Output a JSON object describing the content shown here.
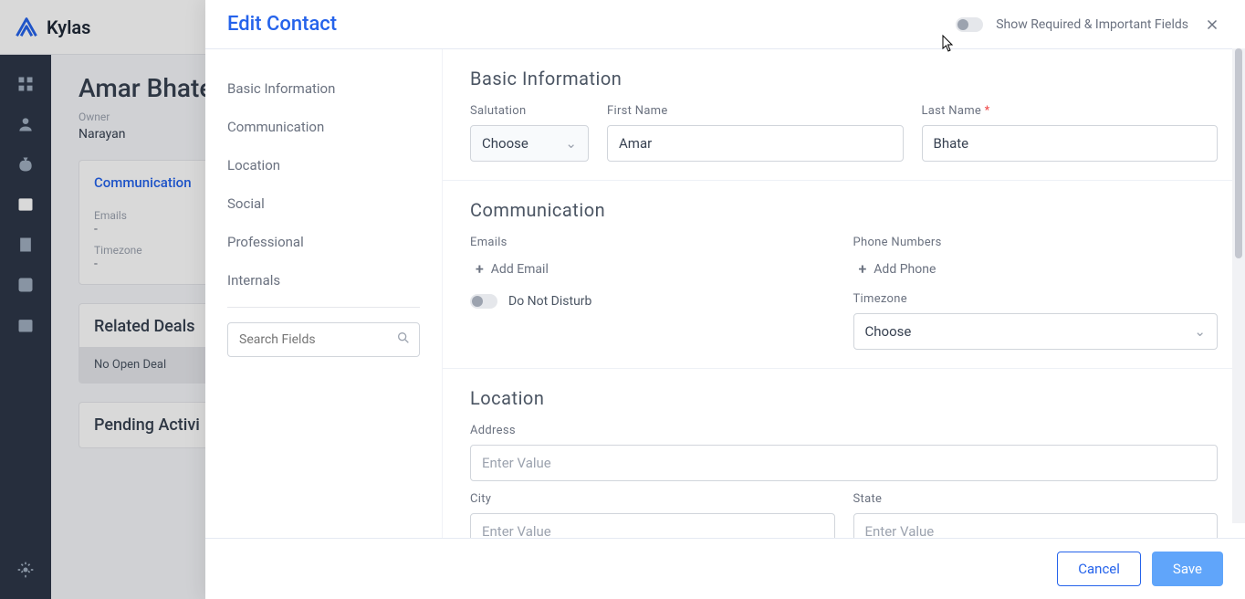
{
  "app": {
    "name": "Kylas"
  },
  "background": {
    "contact_name": "Amar Bhate(",
    "owner_label": "Owner",
    "owner_name": "Narayan",
    "tab_communication": "Communication",
    "emails_label": "Emails",
    "emails_value": "-",
    "timezone_label": "Timezone",
    "timezone_value": "-",
    "related_deals_title": "Related Deals",
    "no_open_deal": "No Open Deal",
    "de_partial": "De",
    "pending_activities": "Pending Activi"
  },
  "modal": {
    "title": "Edit Contact",
    "toggle_label": "Show Required & Important Fields",
    "sidebar": {
      "items": [
        "Basic Information",
        "Communication",
        "Location",
        "Social",
        "Professional",
        "Internals"
      ],
      "search_placeholder": "Search Fields"
    },
    "sections": {
      "basic": {
        "title": "Basic Information",
        "salutation_label": "Salutation",
        "salutation_value": "Choose",
        "first_name_label": "First Name",
        "first_name_value": "Amar",
        "last_name_label": "Last Name",
        "last_name_value": "Bhate"
      },
      "communication": {
        "title": "Communication",
        "emails_label": "Emails",
        "add_email": "Add Email",
        "phones_label": "Phone Numbers",
        "add_phone": "Add Phone",
        "dnd_label": "Do Not Disturb",
        "timezone_label": "Timezone",
        "timezone_value": "Choose"
      },
      "location": {
        "title": "Location",
        "address_label": "Address",
        "address_placeholder": "Enter Value",
        "city_label": "City",
        "city_placeholder": "Enter Value",
        "state_label": "State",
        "state_placeholder": "Enter Value"
      }
    },
    "footer": {
      "cancel": "Cancel",
      "save": "Save"
    }
  }
}
